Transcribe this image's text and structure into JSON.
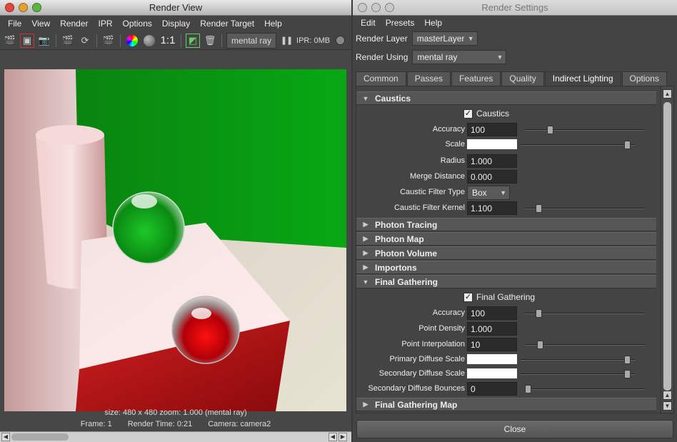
{
  "render_view": {
    "title": "Render View",
    "menu": [
      "File",
      "View",
      "Render",
      "IPR",
      "Options",
      "Display",
      "Render Target",
      "Help"
    ],
    "ratio_label": "1:1",
    "renderer": "mental ray",
    "ipr_status": "IPR: 0MB",
    "status_line1": "size: 480 x 480 zoom: 1.000      (mental ray)",
    "frame": "Frame: 1",
    "render_time": "Render Time: 0:21",
    "camera": "Camera: camera2"
  },
  "render_settings": {
    "title": "Render Settings",
    "menu": [
      "Edit",
      "Presets",
      "Help"
    ],
    "render_layer_label": "Render Layer",
    "render_layer_value": "masterLayer",
    "render_using_label": "Render Using",
    "render_using_value": "mental ray",
    "tabs": [
      "Common",
      "Passes",
      "Features",
      "Quality",
      "Indirect Lighting",
      "Options"
    ],
    "active_tab": "Indirect Lighting",
    "sections": {
      "caustics": "Caustics",
      "photon_tracing": "Photon Tracing",
      "photon_map": "Photon Map",
      "photon_volume": "Photon Volume",
      "importons": "Importons",
      "final_gathering": "Final Gathering",
      "final_gathering_map": "Final Gathering Map"
    },
    "caustics": {
      "checkbox_label": "Caustics",
      "accuracy_label": "Accuracy",
      "accuracy": "100",
      "scale_label": "Scale",
      "radius_label": "Radius",
      "radius": "1.000",
      "merge_distance_label": "Merge Distance",
      "merge_distance": "0.000",
      "filter_type_label": "Caustic Filter Type",
      "filter_type": "Box",
      "filter_kernel_label": "Caustic Filter Kernel",
      "filter_kernel": "1.100"
    },
    "final_gathering": {
      "checkbox_label": "Final Gathering",
      "accuracy_label": "Accuracy",
      "accuracy": "100",
      "point_density_label": "Point Density",
      "point_density": "1.000",
      "point_interpolation_label": "Point Interpolation",
      "point_interpolation": "10",
      "primary_diffuse_label": "Primary Diffuse Scale",
      "secondary_diffuse_label": "Secondary Diffuse Scale",
      "secondary_bounces_label": "Secondary Diffuse Bounces",
      "secondary_bounces": "0"
    },
    "close_label": "Close"
  },
  "colors": {
    "accent_tab": "#444444",
    "scene_green": "#0a9a12",
    "scene_red": "#c4201f"
  }
}
